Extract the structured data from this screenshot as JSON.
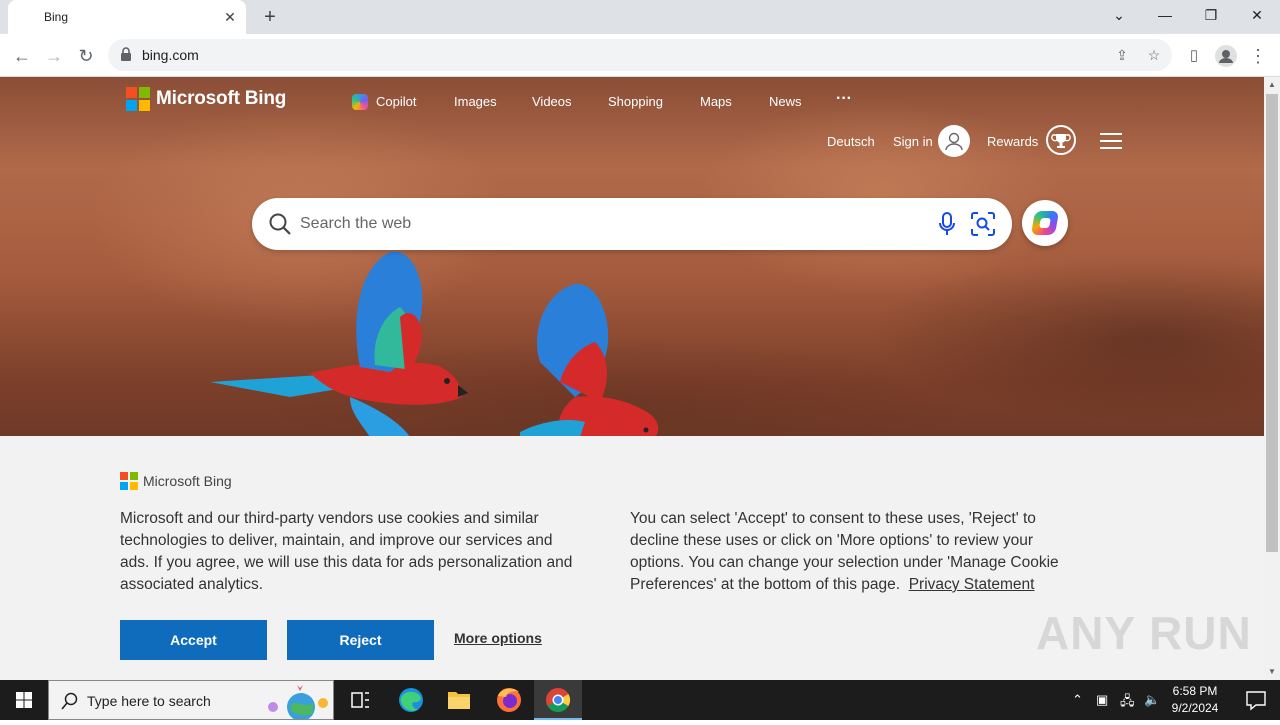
{
  "browser": {
    "tab_title": "Bing",
    "url": "bing.com"
  },
  "header": {
    "logo_text": "Microsoft Bing",
    "nav": [
      "Copilot",
      "Images",
      "Videos",
      "Shopping",
      "Maps",
      "News"
    ],
    "more": "···",
    "language": "Deutsch",
    "sign_in": "Sign in",
    "rewards": "Rewards"
  },
  "search": {
    "placeholder": "Search the web"
  },
  "consent": {
    "logo_text": "Microsoft Bing",
    "left_text": "Microsoft and our third-party vendors use cookies and similar technologies to deliver, maintain, and improve our services and ads. If you agree, we will use this data for ads personalization and associated analytics.",
    "right_text": "You can select 'Accept' to consent to these uses, 'Reject' to decline these uses or click on 'More options' to review your options. You can change your selection under 'Manage Cookie Preferences' at the bottom of this page.",
    "privacy_link": "Privacy Statement",
    "accept": "Accept",
    "reject": "Reject",
    "more_options": "More options",
    "watermark": "ANY RUN"
  },
  "taskbar": {
    "search_placeholder": "Type here to search",
    "time": "6:58 PM",
    "date": "9/2/2024"
  },
  "colors": {
    "accent": "#0f6cbd",
    "banner_bg": "#f2f2f2",
    "taskbar": "#1c1c1c"
  }
}
